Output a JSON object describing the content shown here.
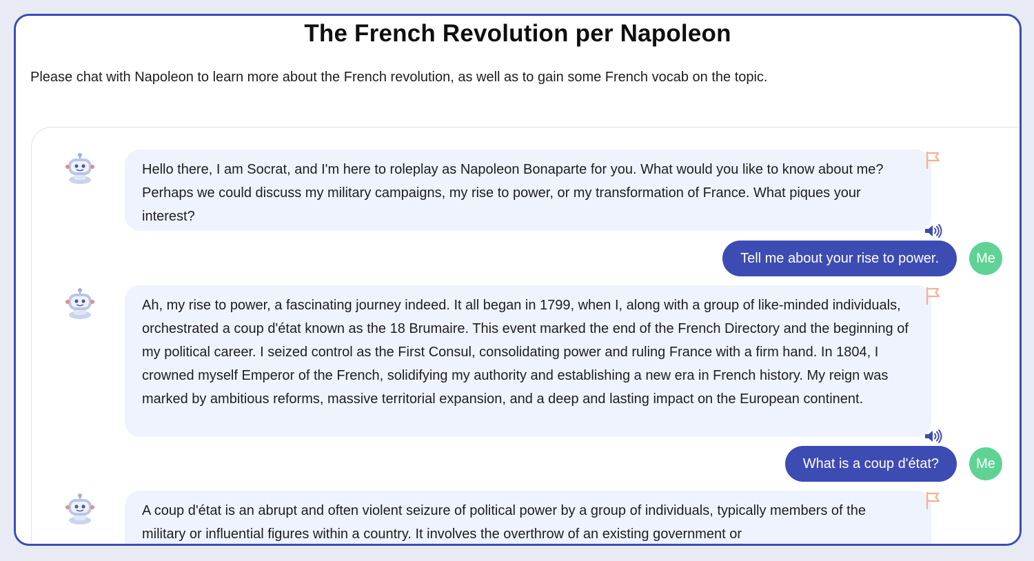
{
  "page": {
    "title": "The French Revolution per Napoleon",
    "subtitle": "Please chat with Napoleon to learn more about the French revolution, as well as to gain some French vocab on the topic."
  },
  "chat": {
    "user_avatar_label": "Me",
    "messages": [
      {
        "role": "bot",
        "text": "Hello there, I am Socrat, and I'm here to roleplay as Napoleon Bonaparte for you. What would you like to know about me? Perhaps we could discuss my military campaigns, my rise to power, or my transformation of France. What piques your interest?"
      },
      {
        "role": "user",
        "text": "Tell me about your rise to power."
      },
      {
        "role": "bot",
        "text": "Ah, my rise to power, a fascinating journey indeed. It all began in 1799, when I, along with a group of like-minded individuals, orchestrated a coup d'état known as the 18 Brumaire. This event marked the end of the French Directory and the beginning of my political career. I seized control as the First Consul, consolidating power and ruling France with a firm hand. In 1804, I crowned myself Emperor of the French, solidifying my authority and establishing a new era in French history. My reign was marked by ambitious reforms, massive territorial expansion, and a deep and lasting impact on the European continent."
      },
      {
        "role": "user",
        "text": "What is a coup d'état?"
      },
      {
        "role": "bot",
        "text": "A coup d'état is an abrupt and often violent seizure of political power by a group of individuals, typically members of the military or influential figures within a country. It involves the overthrow of an existing government or"
      }
    ]
  },
  "icons": {
    "flag": "flag-icon",
    "speaker": "speaker-icon",
    "bot_avatar": "robot-avatar-icon"
  },
  "colors": {
    "frame_border": "#3b4db3",
    "user_bubble": "#3d4cb3",
    "bot_bubble": "#eff3fd",
    "me_avatar": "#5fd395",
    "flag": "#f4b294",
    "speaker": "#3d4cb3"
  }
}
